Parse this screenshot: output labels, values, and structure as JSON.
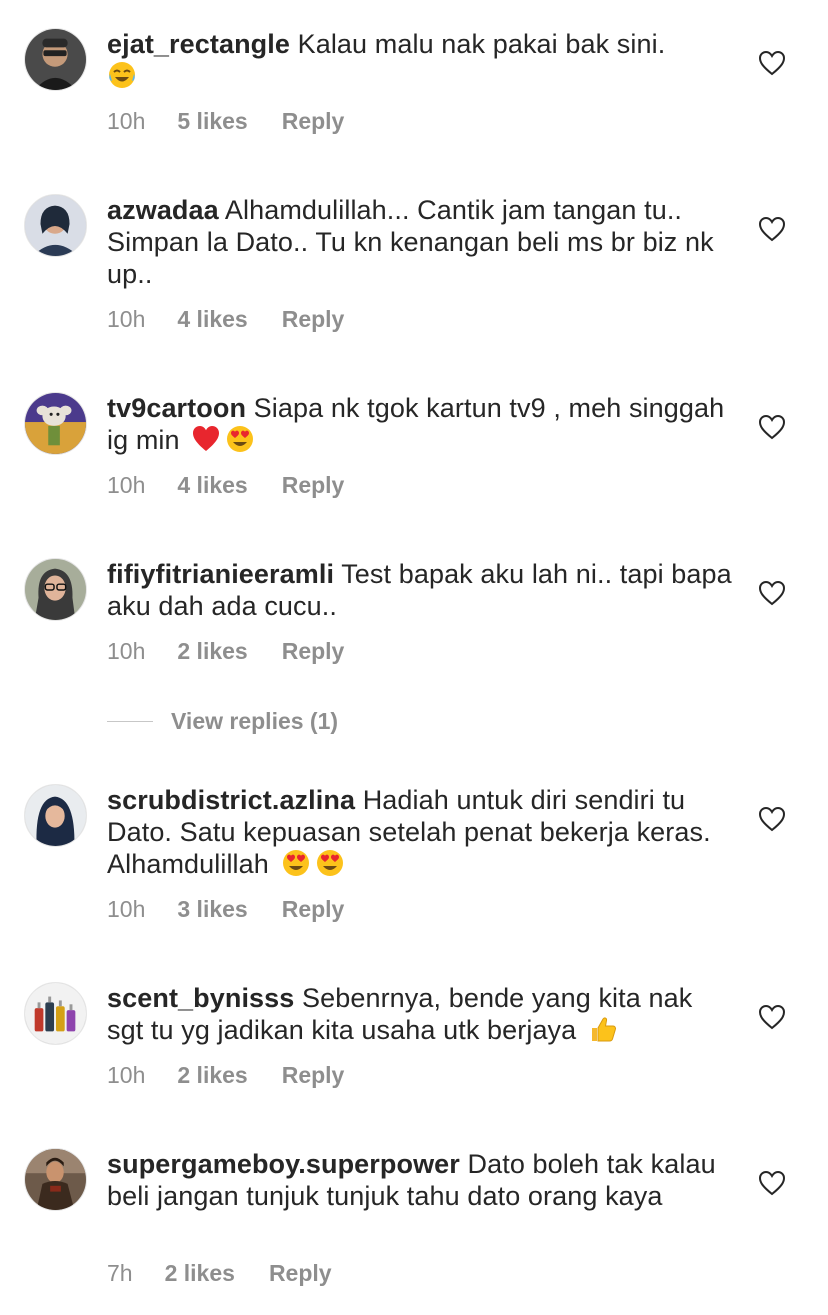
{
  "comments": [
    {
      "username": "ejat_rectangle",
      "text": "Kalau malu nak pakai bak sini.",
      "time": "10h",
      "likes": "5 likes",
      "reply": "Reply",
      "emojis": [
        "joy-emoji"
      ]
    },
    {
      "username": "azwadaa",
      "text": "Alhamdulillah... Cantik jam tangan tu.. Simpan la Dato.. Tu kn kenangan beli ms br biz nk up..",
      "time": "10h",
      "likes": "4 likes",
      "reply": "Reply",
      "emojis": []
    },
    {
      "username": "tv9cartoon",
      "text": "Siapa nk tgok kartun tv9 , meh singgah ig min",
      "time": "10h",
      "likes": "4 likes",
      "reply": "Reply",
      "emojis": [
        "red-heart-emoji",
        "heart-eyes-emoji"
      ]
    },
    {
      "username": "fifiyfitrianieeramli",
      "text": "Test bapak aku lah ni.. tapi bapa aku dah ada cucu..",
      "time": "10h",
      "likes": "2 likes",
      "reply": "Reply",
      "emojis": []
    },
    {
      "username": "scrubdistrict.azlina",
      "text": "Hadiah untuk diri sendiri tu Dato. Satu kepuasan setelah penat bekerja keras. Alhamdulillah",
      "time": "10h",
      "likes": "3 likes",
      "reply": "Reply",
      "emojis": [
        "heart-eyes-emoji",
        "heart-eyes-emoji"
      ]
    },
    {
      "username": "scent_bynisss",
      "text": "Sebenrnya, bende yang kita nak sgt tu yg jadikan kita usaha utk berjaya",
      "time": "10h",
      "likes": "2 likes",
      "reply": "Reply",
      "emojis": [
        "thumbs-up-emoji"
      ]
    },
    {
      "username": "supergameboy.superpower",
      "text": "Dato boleh tak kalau beli jangan tunjuk tunjuk tahu dato orang kaya",
      "time": "7h",
      "likes": "2 likes",
      "reply": "Reply",
      "emojis": []
    }
  ],
  "view_replies": "View replies (1)",
  "colors": {
    "text": "#262626",
    "secondary": "#8e8e8e",
    "divider": "#c7c7c7"
  }
}
